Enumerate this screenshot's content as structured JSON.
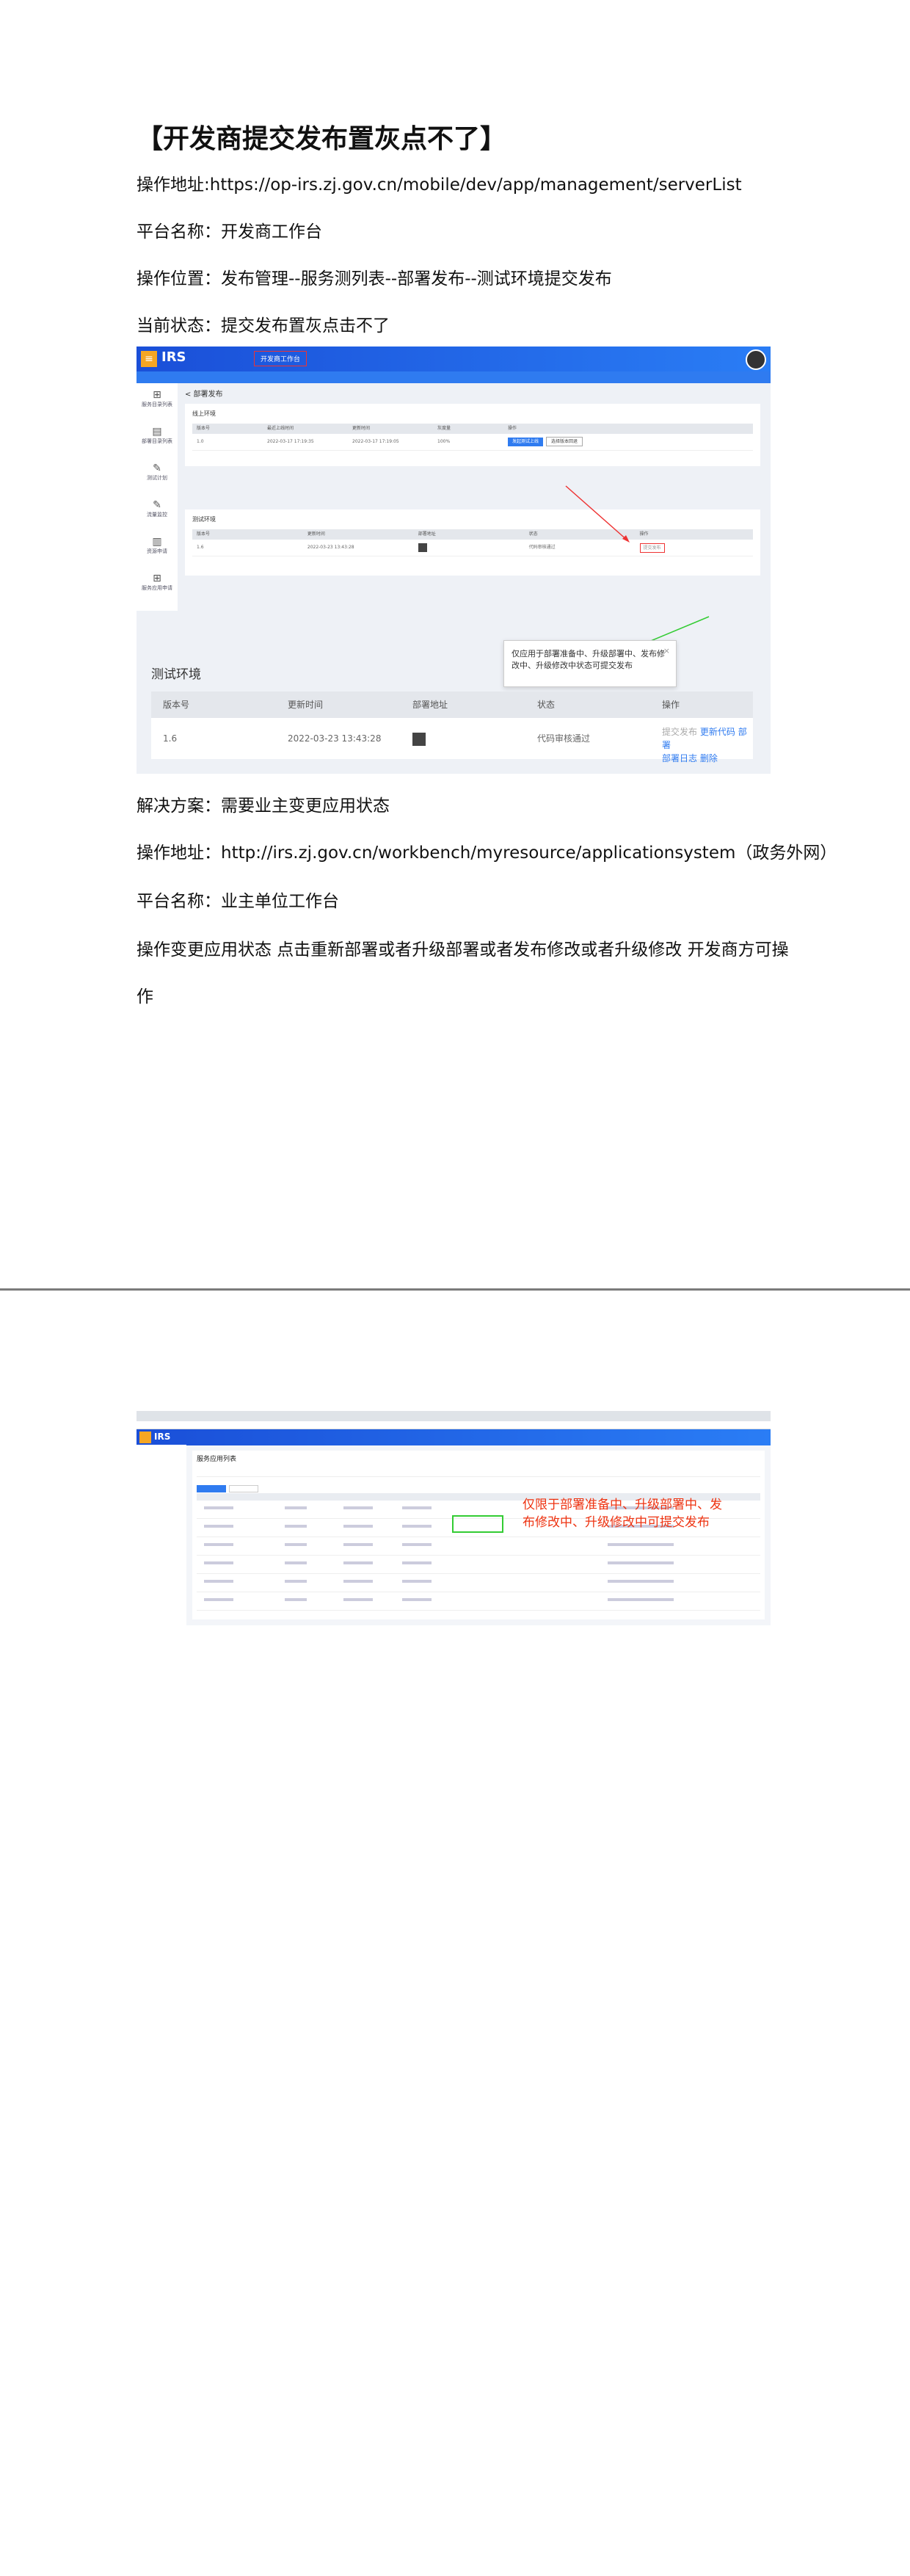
{
  "page1": {
    "title": "【开发商提交发布置灰点不了】",
    "lines": [
      "操作地址:https://op-irs.zj.gov.cn/mobile/dev/app/management/serverList",
      "平台名称：开发商工作台",
      "操作位置：发布管理--服务测列表--部署发布--测试环境提交发布",
      "当前状态：提交发布置灰点击不了",
      "解决方案：需要业主变更应用状态",
      "操作地址：http://irs.zj.gov.cn/workbench/myresource/applicationsystem（政务外网）",
      "平台名称：业主单位工作台",
      "操作变更应用状态  点击重新部署或者升级部署或者发布修改或者升级修改  开发商方可操",
      "作"
    ]
  },
  "shot1": {
    "brand": "IRS",
    "workbench": "开发商工作台",
    "crumb": "< 部署发布",
    "panel_online": "线上环境",
    "panel_test": "测试环境",
    "side": [
      "服务目录列表",
      "部署目录列表",
      "测试计划",
      "流量监控",
      "资源申请",
      "服务应用申请"
    ],
    "table_head_a": [
      "版本号",
      "最近上线时间",
      "更新时间",
      "灰度量",
      "操作"
    ],
    "row_a": [
      "1.0",
      "2022-03-17 17:19:35",
      "2022-03-17 17:19:05",
      "100%"
    ],
    "btn_a1": "发起测试上线",
    "btn_a2": "选择版本回退",
    "table_head_b": [
      "版本号",
      "更新时间",
      "部署地址",
      "状态",
      "操作"
    ],
    "row_b": [
      "1.6",
      "2022-03-23 13:43:28",
      "",
      "代码审核通过"
    ],
    "submit": "提交发布"
  },
  "shot2": {
    "title": "测试环境",
    "head": [
      "版本号",
      "更新时间",
      "部署地址",
      "状态",
      "操作"
    ],
    "row": [
      "1.6",
      "2022-03-23 13:43:28",
      "",
      "代码审核通过"
    ],
    "ops": [
      "提交发布",
      "更新代码",
      "部署",
      "部署日志",
      "删除"
    ],
    "tip": "仅应用于部署准备中、升级部署中、发布修改中、升级修改中状态可提交发布",
    "tip_close": "×"
  },
  "shot3": {
    "brand": "IRS",
    "title": "服务应用列表",
    "note": "仅限于部署准备中、升级部署中、发布修改中、升级修改中可提交发布"
  }
}
